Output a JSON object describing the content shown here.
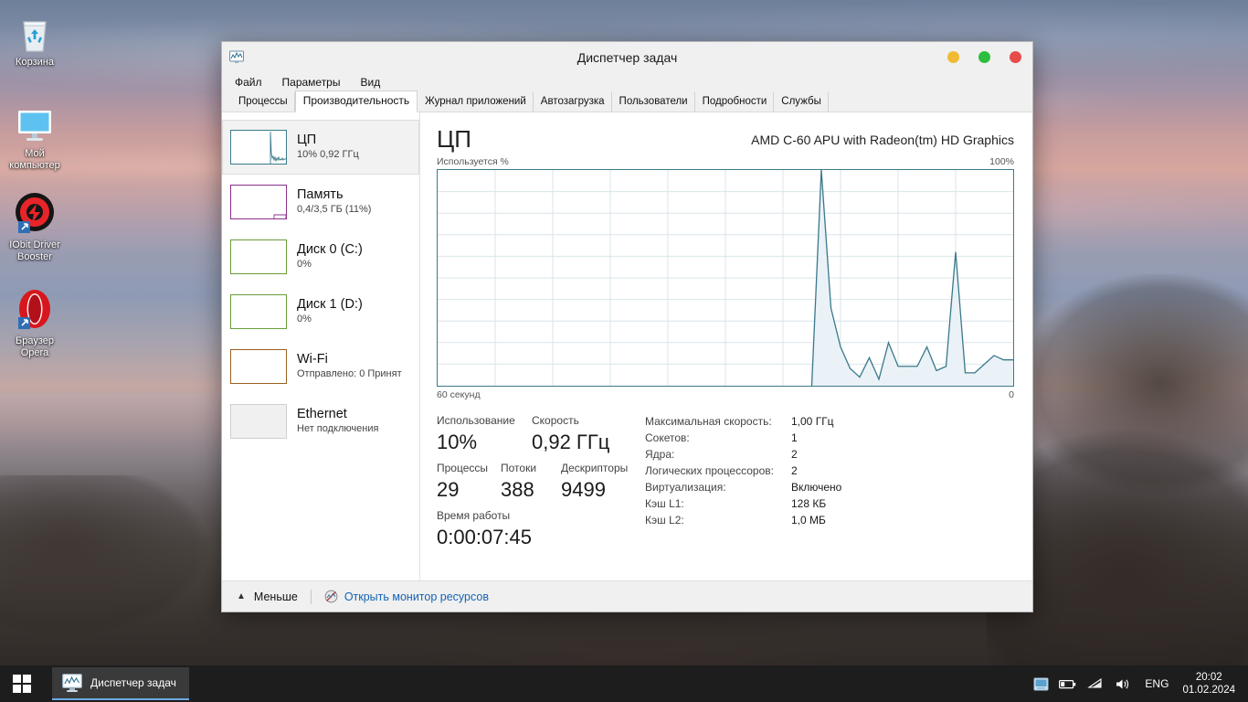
{
  "desktop": {
    "icons": [
      {
        "name": "recycle-bin",
        "label": "Корзина"
      },
      {
        "name": "my-computer",
        "label": "Мой\nкомпьютер"
      },
      {
        "name": "iobit-driver-booster",
        "label": "IObit Driver\nBooster"
      },
      {
        "name": "opera-browser",
        "label": "Браузер\nOpera"
      }
    ]
  },
  "window": {
    "title": "Диспетчер задач",
    "icon": "task-manager-icon",
    "buttons": {
      "minimize_color": "#f0bb32",
      "maximize_color": "#2dbe3d",
      "close_color": "#e64c4c"
    },
    "menu": [
      "Файл",
      "Параметры",
      "Вид"
    ],
    "tabs": [
      {
        "label": "Процессы",
        "active": false
      },
      {
        "label": "Производительность",
        "active": true
      },
      {
        "label": "Журнал приложений",
        "active": false
      },
      {
        "label": "Автозагрузка",
        "active": false
      },
      {
        "label": "Пользователи",
        "active": false
      },
      {
        "label": "Подробности",
        "active": false
      },
      {
        "label": "Службы",
        "active": false
      }
    ]
  },
  "sidebar": {
    "items": [
      {
        "title": "ЦП",
        "sub": "10%  0,92 ГГц",
        "color": "#3b7a8c",
        "selected": true
      },
      {
        "title": "Память",
        "sub": "0,4/3,5 ГБ (11%)",
        "color": "#8c2f8c",
        "selected": false
      },
      {
        "title": "Диск 0 (C:)",
        "sub": "0%",
        "color": "#6a9c3c",
        "selected": false
      },
      {
        "title": "Диск 1 (D:)",
        "sub": "0%",
        "color": "#6a9c3c",
        "selected": false
      },
      {
        "title": "Wi-Fi",
        "sub": "Отправлено: 0 Принят",
        "color": "#9a6122",
        "selected": false
      },
      {
        "title": "Ethernet",
        "sub": "Нет подключения",
        "color": "#c8c8c8",
        "selected": false
      }
    ]
  },
  "main": {
    "heading": "ЦП",
    "model": "AMD C-60 APU with Radeon(tm) HD Graphics",
    "graph_top_left_label": "Используется %",
    "graph_top_right_label": "100%",
    "graph_bottom_left_label": "60 секунд",
    "graph_bottom_right_label": "0",
    "stats": {
      "utilization_label": "Использование",
      "utilization_value": "10%",
      "speed_label": "Скорость",
      "speed_value": "0,92 ГГц",
      "processes_label": "Процессы",
      "processes_value": "29",
      "threads_label": "Потоки",
      "threads_value": "388",
      "handles_label": "Дескрипторы",
      "handles_value": "9499",
      "uptime_label": "Время работы",
      "uptime_value": "0:00:07:45"
    },
    "details": [
      {
        "key": "Максимальная скорость:",
        "value": "1,00 ГГц"
      },
      {
        "key": "Сокетов:",
        "value": "1"
      },
      {
        "key": "Ядра:",
        "value": "2"
      },
      {
        "key": "Логических процессоров:",
        "value": "2"
      },
      {
        "key": "Виртуализация:",
        "value": "Включено"
      },
      {
        "key": "Кэш L1:",
        "value": "128 КБ"
      },
      {
        "key": "Кэш L2:",
        "value": "1,0 МБ"
      }
    ]
  },
  "footer": {
    "fewer_label": "Меньше",
    "resource_monitor_label": "Открыть монитор ресурсов",
    "link_color": "#1463b5"
  },
  "taskbar": {
    "task_label": "Диспетчер задач",
    "language": "ENG",
    "time": "20:02",
    "date": "01.02.2024"
  },
  "chart_data": {
    "type": "area",
    "title": "Используется %",
    "xlabel": "60 секунд",
    "ylabel": "Используется %",
    "ylim": [
      0,
      100
    ],
    "xlim": [
      0,
      60
    ],
    "grid": true,
    "x_axis_right_label": "0",
    "y_axis_top_label": "100%",
    "legend": "none",
    "series": [
      {
        "name": "ЦП",
        "line_color": "#3b7a8c",
        "fill_color": "#eaf2f7",
        "note": "History only fills rightmost ~21 seconds; left portion empty (recent boot)",
        "x": [
          39,
          40,
          41,
          42,
          43,
          44,
          45,
          46,
          47,
          48,
          49,
          50,
          51,
          52,
          53,
          54,
          55,
          56,
          57,
          58,
          59,
          60
        ],
        "values": [
          0,
          100,
          36,
          18,
          8,
          4,
          13,
          3,
          20,
          9,
          9,
          9,
          18,
          7,
          9,
          62,
          6,
          6,
          10,
          14,
          12,
          12
        ]
      }
    ]
  }
}
